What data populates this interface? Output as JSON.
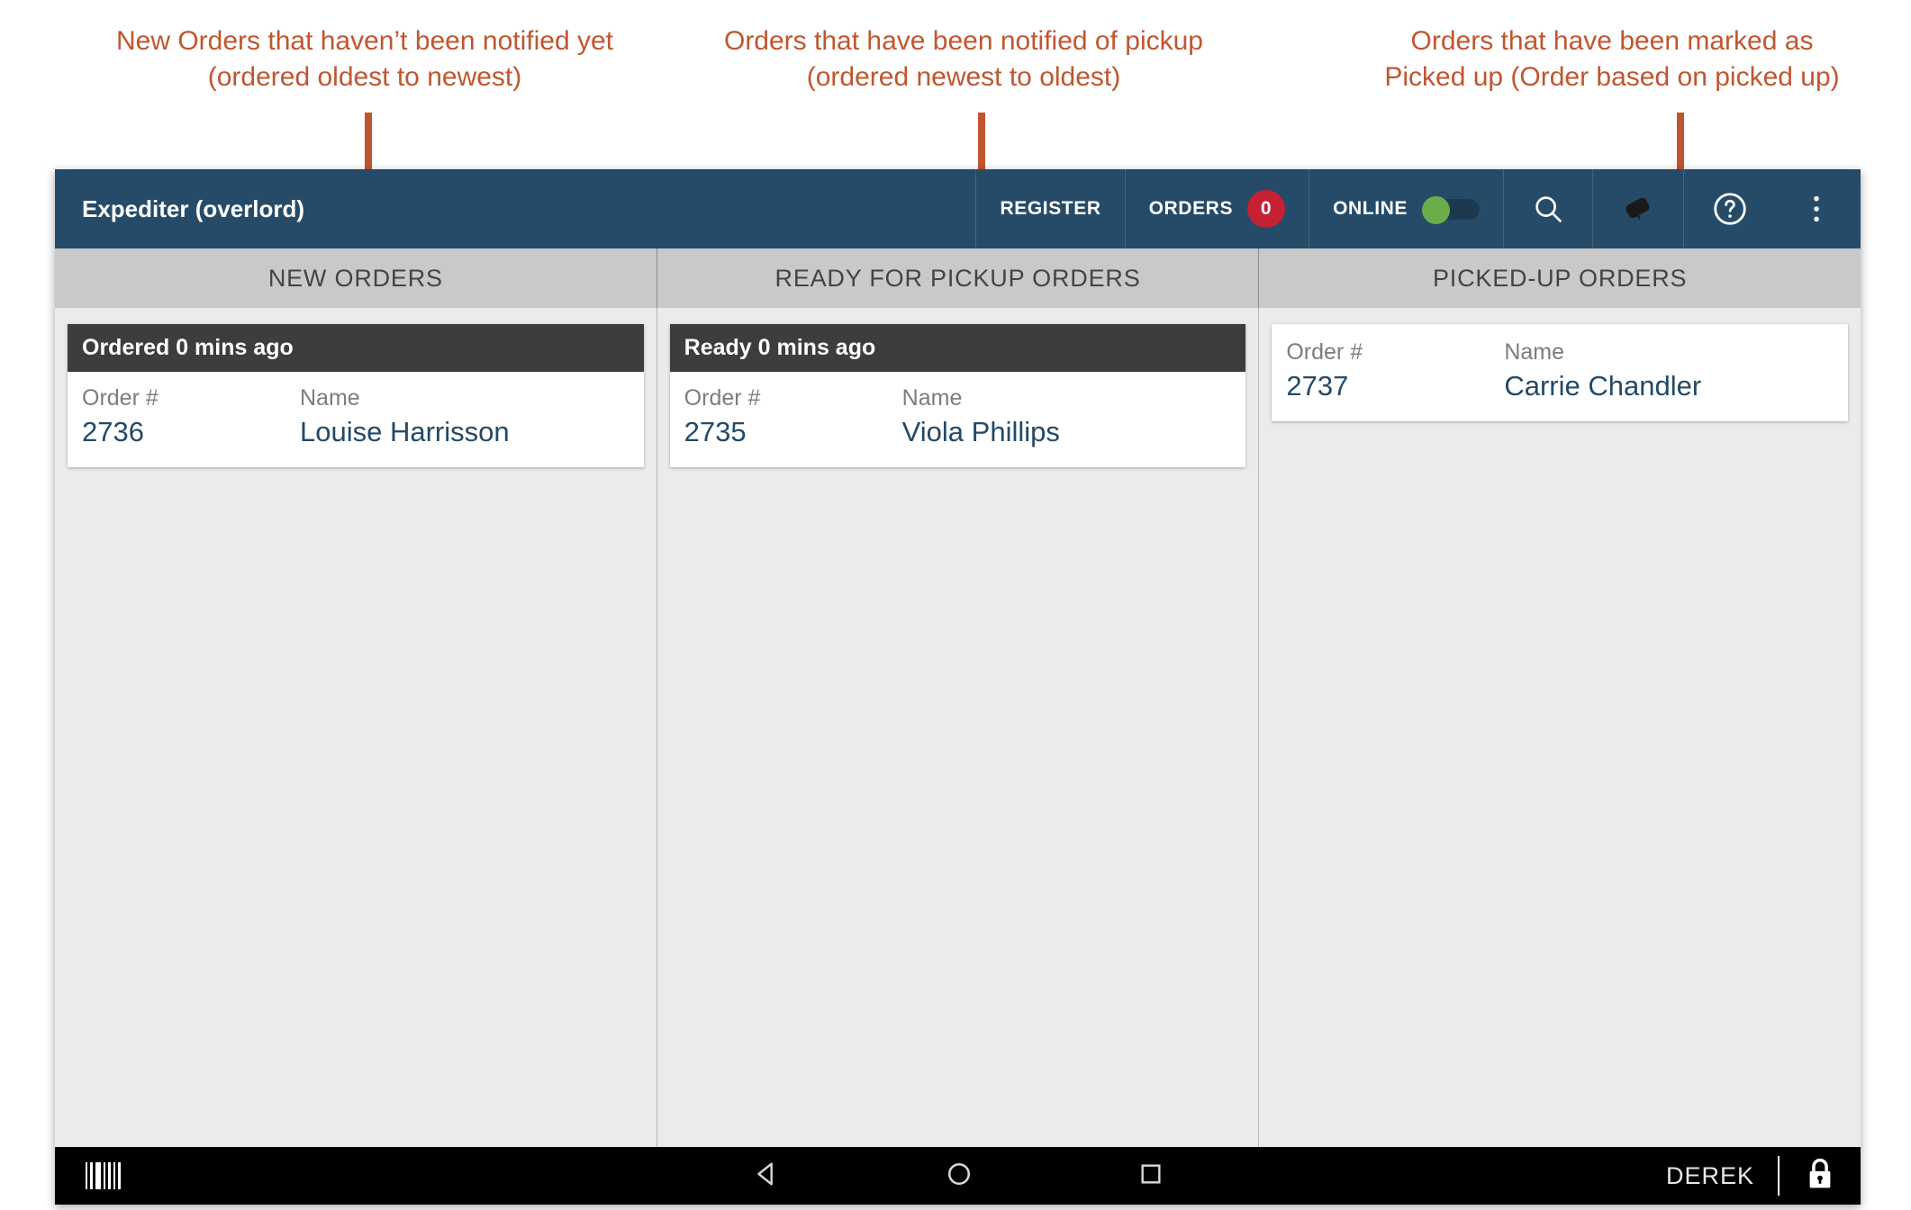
{
  "annotations": [
    {
      "text": "New Orders that haven’t been notified yet\n(ordered oldest to newest)"
    },
    {
      "text": "Orders that have been notified of pickup\n(ordered newest to oldest)"
    },
    {
      "text": "Orders that have been marked as\nPicked up (Order based on picked up)"
    }
  ],
  "appbar": {
    "title": "Expediter (overlord)",
    "register_label": "REGISTER",
    "orders_label": "ORDERS",
    "orders_badge": "0",
    "online_label": "ONLINE",
    "online_state": "on",
    "icons": {
      "search": "search-icon",
      "tag": "tag-icon",
      "help": "help-circle-icon",
      "overflow": "more-vertical-icon"
    },
    "colors": {
      "appbar_bg": "#254b68",
      "badge_bg": "#c62033",
      "toggle_on": "#6aad4b"
    }
  },
  "columns": [
    {
      "header": "NEW ORDERS",
      "cards": [
        {
          "time_label": "Ordered 0 mins ago",
          "order_label": "Order #",
          "order_number": "2736",
          "name_label": "Name",
          "name": "Louise Harrisson"
        }
      ]
    },
    {
      "header": "READY FOR PICKUP ORDERS",
      "cards": [
        {
          "time_label": "Ready 0 mins ago",
          "order_label": "Order #",
          "order_number": "2735",
          "name_label": "Name",
          "name": "Viola Phillips"
        }
      ]
    },
    {
      "header": "PICKED-UP ORDERS",
      "cards": [
        {
          "time_label": "",
          "order_label": "Order #",
          "order_number": "2737",
          "name_label": "Name",
          "name": "Carrie Chandler"
        }
      ]
    }
  ],
  "system_bar": {
    "scanner_icon": "barcode-icon",
    "back_icon": "back-triangle-icon",
    "home_icon": "home-circle-icon",
    "recents_icon": "recents-square-icon",
    "user_name": "DEREK",
    "lock_icon": "lock-icon"
  }
}
